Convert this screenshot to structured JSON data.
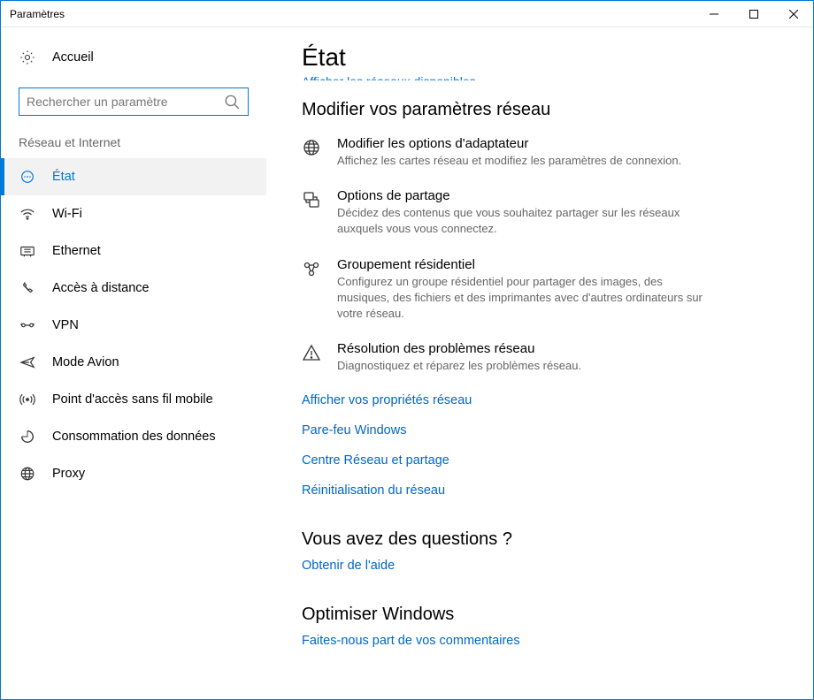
{
  "window": {
    "title": "Paramètres"
  },
  "sidebar": {
    "home_label": "Accueil",
    "search_placeholder": "Rechercher un paramètre",
    "category": "Réseau et Internet",
    "items": [
      {
        "label": "État",
        "active": true
      },
      {
        "label": "Wi-Fi",
        "active": false
      },
      {
        "label": "Ethernet",
        "active": false
      },
      {
        "label": "Accès à distance",
        "active": false
      },
      {
        "label": "VPN",
        "active": false
      },
      {
        "label": "Mode Avion",
        "active": false
      },
      {
        "label": "Point d'accès sans fil mobile",
        "active": false
      },
      {
        "label": "Consommation des données",
        "active": false
      },
      {
        "label": "Proxy",
        "active": false
      }
    ]
  },
  "main": {
    "title": "État",
    "truncated_link": "Afficher les réseaux disponibles",
    "section_modify": "Modifier vos paramètres réseau",
    "options": [
      {
        "title": "Modifier les options d'adaptateur",
        "desc": "Affichez les cartes réseau et modifiez les paramètres de connexion."
      },
      {
        "title": "Options de partage",
        "desc": "Décidez des contenus que vous souhaitez partager sur les réseaux auxquels vous vous connectez."
      },
      {
        "title": "Groupement résidentiel",
        "desc": "Configurez un groupe résidentiel pour partager des images, des musiques, des fichiers et des imprimantes avec d'autres ordinateurs sur votre réseau."
      },
      {
        "title": "Résolution des problèmes réseau",
        "desc": "Diagnostiquez et réparez les problèmes réseau."
      }
    ],
    "links": [
      "Afficher vos propriétés réseau",
      "Pare-feu Windows",
      "Centre Réseau et partage",
      "Réinitialisation du réseau"
    ],
    "questions_header": "Vous avez des questions ?",
    "help_link": "Obtenir de l'aide",
    "optimize_header": "Optimiser Windows",
    "feedback_link": "Faites-nous part de vos commentaires"
  }
}
